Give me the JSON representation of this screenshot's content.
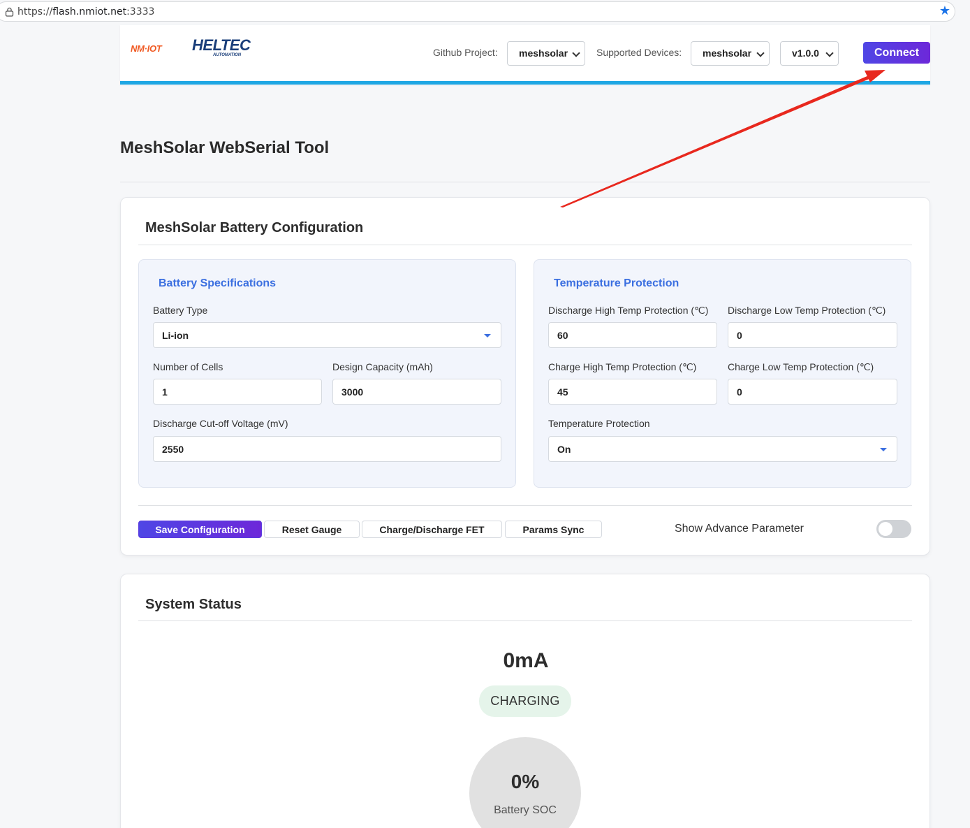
{
  "browser": {
    "url_prefix": "https://",
    "url_host": "flash.nmiot.net",
    "url_suffix": ":3333"
  },
  "header": {
    "logo_nm": "NM·IOT",
    "logo_heltec": "ELTEC",
    "logo_heltec_sub": "AUTOMATION",
    "github_label": "Github Project:",
    "github_value": "meshsolar",
    "devices_label": "Supported Devices:",
    "devices_value": "meshsolar",
    "version_value": "v1.0.0",
    "connect_label": "Connect"
  },
  "page_title": "MeshSolar WebSerial Tool",
  "config": {
    "title": "MeshSolar Battery Configuration",
    "battery": {
      "title": "Battery Specifications",
      "type_label": "Battery Type",
      "type_value": "Li-ion",
      "cells_label": "Number of Cells",
      "cells_value": "1",
      "capacity_label": "Design Capacity (mAh)",
      "capacity_value": "3000",
      "cutoff_label": "Discharge Cut-off Voltage (mV)",
      "cutoff_value": "2550"
    },
    "temperature": {
      "title": "Temperature Protection",
      "dis_high_label": "Discharge High Temp Protection (℃)",
      "dis_high_value": "60",
      "dis_low_label": "Discharge Low Temp Protection (℃)",
      "dis_low_value": "0",
      "chg_high_label": "Charge High Temp Protection (℃)",
      "chg_high_value": "45",
      "chg_low_label": "Charge Low Temp Protection (℃)",
      "chg_low_value": "0",
      "protect_label": "Temperature Protection",
      "protect_value": "On"
    },
    "buttons": {
      "save": "Save Configuration",
      "reset": "Reset Gauge",
      "fet": "Charge/Discharge FET",
      "sync": "Params Sync"
    },
    "advance_label": "Show Advance Parameter",
    "advance_on": false
  },
  "status": {
    "title": "System Status",
    "current": "0mA",
    "state": "CHARGING",
    "soc_value": "0%",
    "soc_label": "Battery SOC"
  },
  "colors": {
    "accent": "#4f46e5",
    "header_rule": "#1ea7e4",
    "panel_title": "#3b6fe0",
    "annotation_arrow": "#e8281e"
  }
}
